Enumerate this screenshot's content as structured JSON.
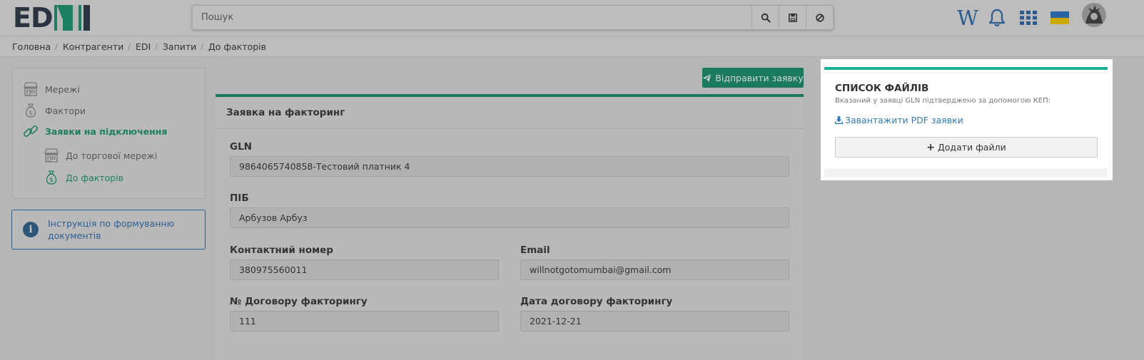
{
  "header": {
    "logo_text": "ED",
    "search_placeholder": "Пошук",
    "icons": [
      "search-icon",
      "save-icon",
      "clear-icon",
      "wikipedia-icon",
      "bell-icon",
      "apps-grid-icon",
      "flag-ukraine-icon",
      "avatar"
    ]
  },
  "breadcrumb": [
    "Головна",
    "Контрагенти",
    "EDI",
    "Запити",
    "До факторів"
  ],
  "sidebar": {
    "items": [
      {
        "label": "Мережі",
        "icon": "store-icon"
      },
      {
        "label": "Фактори",
        "icon": "money-bag-icon"
      },
      {
        "label": "Заявки на підключення",
        "icon": "link-icon"
      }
    ],
    "subitems": [
      {
        "label": "До торгової мережі",
        "icon": "store-icon"
      },
      {
        "label": "До факторів",
        "icon": "money-bag-icon"
      }
    ],
    "info_text": "Інструкція по формуванню документів"
  },
  "main": {
    "send_button": "Відправити заявку",
    "title": "Заявка на факторинг",
    "fields": {
      "gln": {
        "label": "GLN",
        "value": "9864065740858-Тестовий платник 4"
      },
      "name": {
        "label": "ПІБ",
        "value": "Арбузов Арбуз"
      },
      "phone": {
        "label": "Контактний номер",
        "value": "380975560011"
      },
      "email": {
        "label": "Email",
        "value": "willnotgotomumbai@gmail.com"
      },
      "contract_no": {
        "label": "№ Договору факторингу",
        "value": "111"
      },
      "contract_date": {
        "label": "Дата договору факторингу",
        "value": "2021-12-21"
      }
    }
  },
  "files": {
    "title": "СПИСОК ФАЙЛІВ",
    "note": "Вказаний у заявці GLN підтверджено за допомогою КЕП:",
    "download_link": "Завантажити PDF заявки",
    "add_button": "Додати файли"
  },
  "colors": {
    "accent": "#1ab394",
    "brand_green": "#1d7f61",
    "link": "#337ab7"
  }
}
